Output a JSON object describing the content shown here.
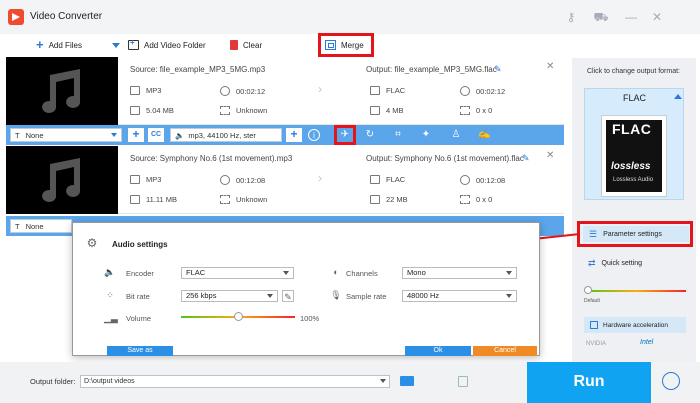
{
  "window": {
    "title": "Video Converter",
    "controls": [
      "key",
      "cart",
      "minimize",
      "close"
    ]
  },
  "toolbar": {
    "add_files": "Add Files",
    "add_video_folder": "Add Video Folder",
    "clear": "Clear",
    "merge": "Merge"
  },
  "files": [
    {
      "source": "Source: file_example_MP3_5MG.mp3",
      "output": "Output: file_example_MP3_5MG.flac",
      "src_format": "MP3",
      "src_duration": "00:02:12",
      "src_size": "5.04 MB",
      "src_res": "Unknown",
      "out_format": "FLAC",
      "out_duration": "00:02:12",
      "out_size": "4 MB",
      "out_res": "0 x 0",
      "subtitle": "None",
      "audio_track": "mp3, 44100 Hz, ster"
    },
    {
      "source": "Source: Symphony No.6 (1st movement).mp3",
      "output": "Output: Symphony No.6 (1st movement).flac",
      "src_format": "MP3",
      "src_duration": "00:12:08",
      "src_size": "11.11 MB",
      "src_res": "Unknown",
      "out_format": "FLAC",
      "out_duration": "00:12:08",
      "out_size": "22 MB",
      "out_res": "0 x 0",
      "subtitle": "None"
    }
  ],
  "cc_label": "CC",
  "right_panel": {
    "hint": "Click to change output format:",
    "format": "FLAC",
    "card_title": "FLAC",
    "card_logo": "lossless",
    "card_caption": "Lossless Audio",
    "parameter_settings": "Parameter settings",
    "quick_setting": "Quick setting",
    "slider_default": "Default",
    "slider_level": 0.0,
    "hardware_acceleration": "Hardware acceleration",
    "nvidia": "NVIDIA",
    "intel": "Intel"
  },
  "dialog": {
    "title": "Audio settings",
    "encoder_label": "Encoder",
    "encoder_value": "FLAC",
    "bitrate_label": "Bit rate",
    "bitrate_value": "256 kbps",
    "volume_label": "Volume",
    "volume_value": "100%",
    "volume_level": 0.5,
    "channels_label": "Channels",
    "channels_value": "Mono",
    "samplerate_label": "Sample rate",
    "samplerate_value": "48000 Hz",
    "save_as": "Save as",
    "ok": "Ok",
    "cancel": "Cancel"
  },
  "bottom": {
    "output_folder_label": "Output folder:",
    "output_folder_value": "D:\\output videos",
    "run": "Run"
  },
  "colors": {
    "accent_blue": "#5ba6ea",
    "run_blue": "#0fa3f2",
    "highlight_red": "#e3141a",
    "cancel_orange": "#f08a24",
    "logo_red": "#ef4b2f"
  }
}
